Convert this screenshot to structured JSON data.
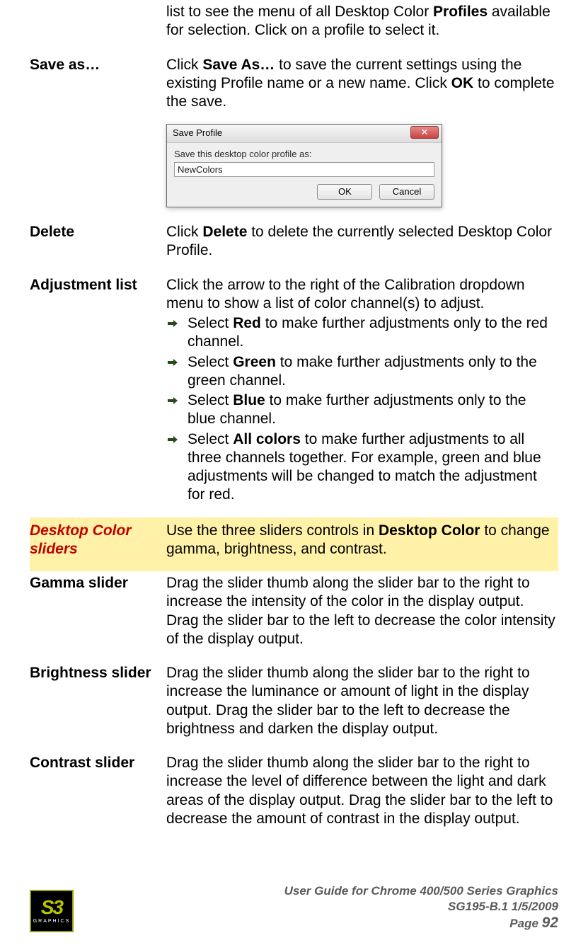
{
  "intro": {
    "prefix": "list to see the menu of all Desktop Color ",
    "bold1": "Profiles",
    "suffix": " available for selection. Click on a profile to select it."
  },
  "saveas": {
    "term": "Save as…",
    "p1a": "Click ",
    "p1b": "Save As…",
    "p1c": " to save the current settings using the existing Profile name or a new name. Click ",
    "p1d": "OK",
    "p1e": " to complete the save."
  },
  "dialog": {
    "title": "Save Profile",
    "label": "Save this desktop color profile as:",
    "value": "NewColors",
    "ok": "OK",
    "cancel": "Cancel",
    "close_glyph": "✕"
  },
  "delete": {
    "term": "Delete",
    "p1a": "Click ",
    "p1b": "Delete",
    "p1c": " to delete the currently selected Desktop Color Profile."
  },
  "adjust": {
    "term": "Adjustment list",
    "intro": "Click the arrow to the right of the Calibration dropdown menu to show a list of color channel(s) to adjust.",
    "items": [
      {
        "a": "Select ",
        "b": "Red",
        "c": " to make further adjustments only to the red channel."
      },
      {
        "a": "Select ",
        "b": "Green",
        "c": " to make further adjustments only to the green channel."
      },
      {
        "a": "Select ",
        "b": "Blue",
        "c": " to make further adjustments only to the blue channel."
      },
      {
        "a": "Select ",
        "b": "All colors",
        "c": " to make further adjustments to all three channels together. For example, green and blue adjustments will be changed to match the adjustment for red."
      }
    ]
  },
  "sliders_section": {
    "term": "Desktop Color sliders",
    "p1a": "Use the three sliders controls in ",
    "p1b": "Desktop Color",
    "p1c": " to change gamma, brightness, and contrast."
  },
  "gamma": {
    "term": "Gamma slider",
    "text": "Drag the slider thumb along the slider bar to the right to increase the intensity of the color in the display output. Drag the slider bar to the left to decrease the color intensity of the display output."
  },
  "brightness": {
    "term": "Brightness slider",
    "text": "Drag the slider thumb along the slider bar to the right to increase the luminance or amount of light in the display output. Drag the slider bar to the left to decrease the brightness and darken the display output."
  },
  "contrast": {
    "term": "Contrast slider",
    "text": "Drag the slider thumb along the slider bar to the right to increase the level of difference between the light and dark areas of the display output. Drag the slider bar to the left to decrease the amount of contrast in the display output."
  },
  "footer": {
    "logo_s3": "S3",
    "logo_sub": "GRAPHICS",
    "line1": "User Guide for Chrome 400/500 Series Graphics",
    "line2": "SG195-B.1   1/5/2009",
    "page_label": "Page ",
    "page_num": "92"
  }
}
